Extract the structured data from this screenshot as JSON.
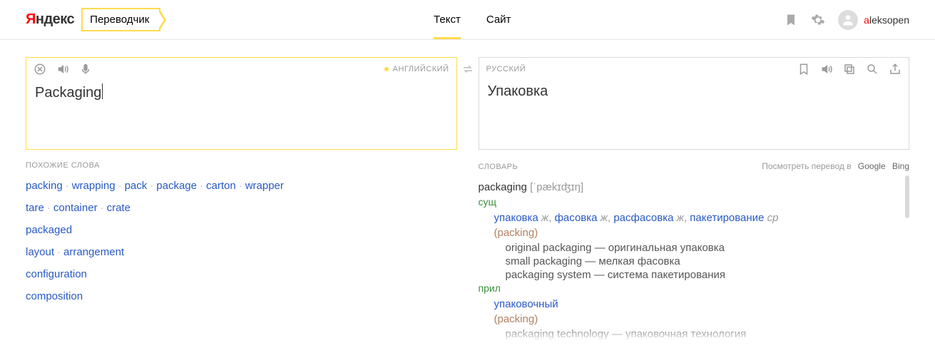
{
  "header": {
    "logo_prefix": "Я",
    "logo_rest": "ндекс",
    "service": "Переводчик",
    "nav": {
      "text": "Текст",
      "site": "Сайт"
    },
    "username_first": "a",
    "username_rest": "leksopen"
  },
  "source": {
    "lang": "АНГЛИЙСКИЙ",
    "text": "Packaging"
  },
  "target": {
    "lang": "РУССКИЙ",
    "text": "Упаковка"
  },
  "similar": {
    "title": "ПОХОЖИЕ СЛОВА",
    "rows": [
      [
        "packing",
        "wrapping",
        "pack",
        "package",
        "carton",
        "wrapper"
      ],
      [
        "tare",
        "container",
        "crate"
      ],
      [
        "packaged"
      ],
      [
        "layout",
        "arrangement"
      ],
      [
        "configuration"
      ],
      [
        "composition"
      ]
    ]
  },
  "dict": {
    "title": "СЛОВАРЬ",
    "external_label": "Посмотреть перевод в",
    "external": [
      "Google",
      "Bing"
    ],
    "headword": "packaging",
    "transcription": "[ˈpækɪʤɪŋ]",
    "entries": [
      {
        "pos": "сущ",
        "translations": [
          {
            "term": "упаковка",
            "gen": "ж"
          },
          {
            "term": "фасовка",
            "gen": "ж"
          },
          {
            "term": "расфасовка",
            "gen": "ж"
          },
          {
            "term": "пакетирование",
            "gen": "ср"
          }
        ],
        "gloss": "(packing)",
        "examples": [
          "original packaging — оригинальная упаковка",
          "small packaging — мелкая фасовка",
          "packaging system — система пакетирования"
        ]
      },
      {
        "pos": "прил",
        "translations": [
          {
            "term": "упаковочный",
            "gen": ""
          }
        ],
        "gloss": "(packing)",
        "examples": [
          "packaging technology — упаковочная технология"
        ]
      }
    ]
  }
}
